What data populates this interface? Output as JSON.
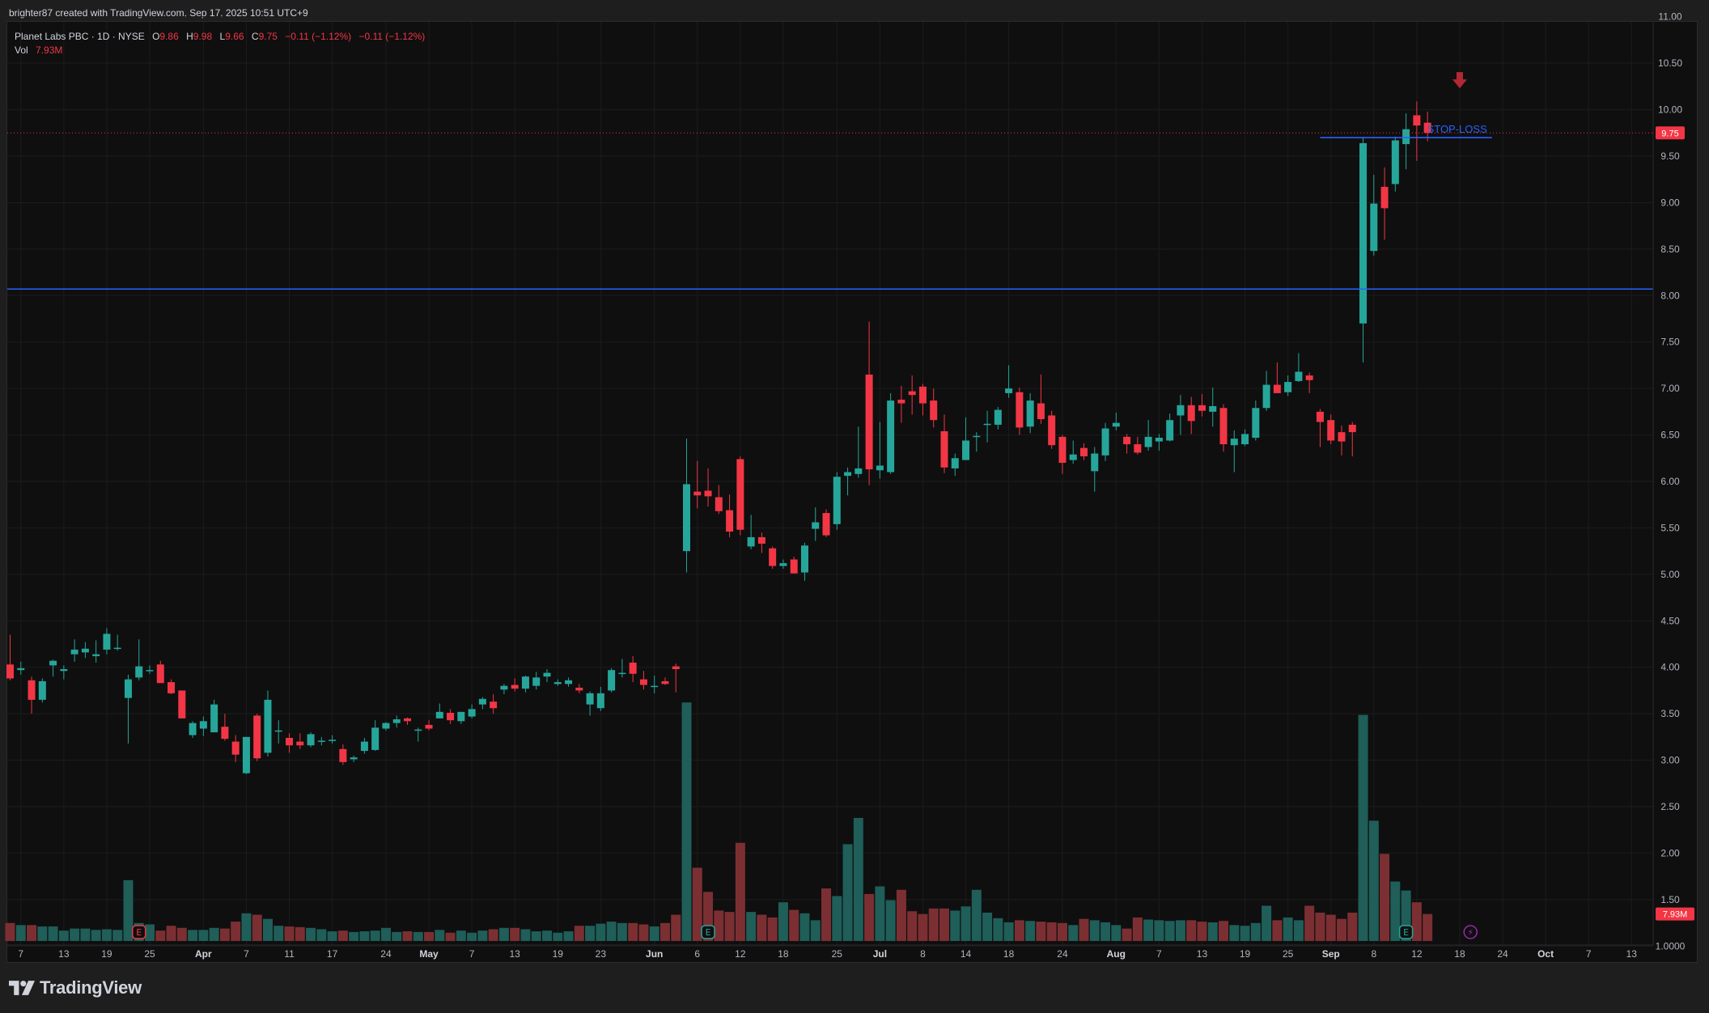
{
  "header": {
    "credit": "brighter87 created with TradingView.com, Sep 17, 2025 10:51 UTC+9"
  },
  "legend": {
    "symbol": "Planet Labs PBC · 1D · NYSE",
    "o_label": "O",
    "o_value": "9.86",
    "h_label": "H",
    "h_value": "9.98",
    "l_label": "L",
    "l_value": "9.66",
    "c_label": "C",
    "c_value": "9.75",
    "change": "−0.11 (−1.12%)",
    "change2": "−0.11 (−1.12%)",
    "vol_label": "Vol",
    "vol_value": "7.93M"
  },
  "footer": {
    "logo_text": "TradingView"
  },
  "colors": {
    "up": "#26a69a",
    "down": "#f23645",
    "up_volume": "#1f5e59",
    "down_volume": "#7c2f32",
    "hline": "#2962ff",
    "background": "#0f0f0f",
    "grid": "#1c1c1c",
    "axis_text": "#b2b5be"
  },
  "chart_data": {
    "type": "candlestick",
    "symbol": "Planet Labs PBC",
    "interval": "1D",
    "exchange": "NYSE",
    "ylim": [
      0.95,
      11.05
    ],
    "y_ticks": [
      "11.00",
      "10.50",
      "10.00",
      "9.50",
      "9.00",
      "8.50",
      "8.00",
      "7.50",
      "7.00",
      "6.50",
      "6.00",
      "5.50",
      "5.00",
      "4.50",
      "4.00",
      "3.50",
      "3.00",
      "2.50",
      "2.00",
      "1.50",
      "1.0000"
    ],
    "x_labels": [
      "7",
      "13",
      "19",
      "25",
      "Apr",
      "7",
      "11",
      "17",
      "24",
      "May",
      "7",
      "13",
      "19",
      "23",
      "Jun",
      "6",
      "12",
      "18",
      "25",
      "Jul",
      "8",
      "14",
      "18",
      "24",
      "Aug",
      "7",
      "13",
      "19",
      "25",
      "Sep",
      "8",
      "12",
      "18",
      "24",
      "Oct",
      "7",
      "13"
    ],
    "x_label_bold": [
      "Apr",
      "May",
      "Jun",
      "Jul",
      "Aug",
      "Sep",
      "Oct"
    ],
    "x_label_bar_pos": [
      1,
      5,
      9,
      13,
      18,
      22,
      26,
      30,
      35,
      39,
      43,
      47,
      51,
      55,
      60,
      64,
      68,
      72,
      77,
      81,
      85,
      89,
      93,
      98,
      103,
      107,
      111,
      115,
      119,
      123,
      127,
      131,
      135,
      139,
      143,
      147,
      151
    ],
    "candles": [
      {
        "o": 4.03,
        "h": 4.35,
        "l": 3.86,
        "c": 3.88
      },
      {
        "o": 3.97,
        "h": 4.06,
        "l": 3.92,
        "c": 3.99
      },
      {
        "o": 3.86,
        "h": 3.9,
        "l": 3.5,
        "c": 3.65
      },
      {
        "o": 3.65,
        "h": 3.88,
        "l": 3.62,
        "c": 3.85
      },
      {
        "o": 4.02,
        "h": 4.08,
        "l": 3.9,
        "c": 4.07
      },
      {
        "o": 3.96,
        "h": 4.02,
        "l": 3.87,
        "c": 3.98
      },
      {
        "o": 4.14,
        "h": 4.3,
        "l": 4.06,
        "c": 4.19
      },
      {
        "o": 4.16,
        "h": 4.27,
        "l": 4.1,
        "c": 4.2
      },
      {
        "o": 4.12,
        "h": 4.29,
        "l": 4.05,
        "c": 4.14
      },
      {
        "o": 4.19,
        "h": 4.42,
        "l": 4.14,
        "c": 4.36
      },
      {
        "o": 4.21,
        "h": 4.35,
        "l": 4.18,
        "c": 4.21
      },
      {
        "o": 3.67,
        "h": 3.92,
        "l": 3.18,
        "c": 3.87
      },
      {
        "o": 3.89,
        "h": 4.3,
        "l": 3.86,
        "c": 4.01
      },
      {
        "o": 3.97,
        "h": 4.02,
        "l": 3.93,
        "c": 3.97
      },
      {
        "o": 4.03,
        "h": 4.07,
        "l": 3.86,
        "c": 3.83
      },
      {
        "o": 3.84,
        "h": 3.87,
        "l": 3.71,
        "c": 3.72
      },
      {
        "o": 3.75,
        "h": 3.75,
        "l": 3.45,
        "c": 3.45
      },
      {
        "o": 3.27,
        "h": 3.42,
        "l": 3.24,
        "c": 3.4
      },
      {
        "o": 3.34,
        "h": 3.47,
        "l": 3.26,
        "c": 3.42
      },
      {
        "o": 3.3,
        "h": 3.65,
        "l": 3.3,
        "c": 3.6
      },
      {
        "o": 3.36,
        "h": 3.5,
        "l": 3.21,
        "c": 3.23
      },
      {
        "o": 3.2,
        "h": 3.27,
        "l": 2.98,
        "c": 3.06
      },
      {
        "o": 2.86,
        "h": 3.25,
        "l": 2.85,
        "c": 3.25
      },
      {
        "o": 3.48,
        "h": 3.5,
        "l": 2.99,
        "c": 3.02
      },
      {
        "o": 3.08,
        "h": 3.75,
        "l": 3.04,
        "c": 3.65
      },
      {
        "o": 3.32,
        "h": 3.43,
        "l": 3.18,
        "c": 3.32
      },
      {
        "o": 3.24,
        "h": 3.29,
        "l": 3.08,
        "c": 3.16
      },
      {
        "o": 3.2,
        "h": 3.29,
        "l": 3.12,
        "c": 3.16
      },
      {
        "o": 3.16,
        "h": 3.3,
        "l": 3.14,
        "c": 3.28
      },
      {
        "o": 3.2,
        "h": 3.25,
        "l": 3.16,
        "c": 3.21
      },
      {
        "o": 3.22,
        "h": 3.27,
        "l": 3.18,
        "c": 3.22
      },
      {
        "o": 3.12,
        "h": 3.17,
        "l": 2.95,
        "c": 2.98
      },
      {
        "o": 3.01,
        "h": 3.05,
        "l": 2.98,
        "c": 3.03
      },
      {
        "o": 3.1,
        "h": 3.24,
        "l": 3.07,
        "c": 3.2
      },
      {
        "o": 3.11,
        "h": 3.43,
        "l": 3.1,
        "c": 3.35
      },
      {
        "o": 3.34,
        "h": 3.41,
        "l": 3.32,
        "c": 3.4
      },
      {
        "o": 3.4,
        "h": 3.48,
        "l": 3.35,
        "c": 3.44
      },
      {
        "o": 3.45,
        "h": 3.46,
        "l": 3.38,
        "c": 3.42
      },
      {
        "o": 3.33,
        "h": 3.35,
        "l": 3.2,
        "c": 3.33
      },
      {
        "o": 3.38,
        "h": 3.43,
        "l": 3.32,
        "c": 3.34
      },
      {
        "o": 3.45,
        "h": 3.61,
        "l": 3.45,
        "c": 3.52
      },
      {
        "o": 3.51,
        "h": 3.55,
        "l": 3.39,
        "c": 3.43
      },
      {
        "o": 3.42,
        "h": 3.52,
        "l": 3.39,
        "c": 3.52
      },
      {
        "o": 3.47,
        "h": 3.6,
        "l": 3.45,
        "c": 3.55
      },
      {
        "o": 3.6,
        "h": 3.68,
        "l": 3.55,
        "c": 3.66
      },
      {
        "o": 3.63,
        "h": 3.71,
        "l": 3.5,
        "c": 3.56
      },
      {
        "o": 3.76,
        "h": 3.82,
        "l": 3.71,
        "c": 3.8
      },
      {
        "o": 3.81,
        "h": 3.88,
        "l": 3.74,
        "c": 3.77
      },
      {
        "o": 3.77,
        "h": 3.91,
        "l": 3.73,
        "c": 3.9
      },
      {
        "o": 3.8,
        "h": 3.95,
        "l": 3.76,
        "c": 3.89
      },
      {
        "o": 3.9,
        "h": 3.98,
        "l": 3.84,
        "c": 3.94
      },
      {
        "o": 3.82,
        "h": 3.87,
        "l": 3.8,
        "c": 3.84
      },
      {
        "o": 3.82,
        "h": 3.89,
        "l": 3.79,
        "c": 3.86
      },
      {
        "o": 3.78,
        "h": 3.82,
        "l": 3.72,
        "c": 3.75
      },
      {
        "o": 3.6,
        "h": 3.74,
        "l": 3.48,
        "c": 3.72
      },
      {
        "o": 3.56,
        "h": 3.79,
        "l": 3.53,
        "c": 3.72
      },
      {
        "o": 3.75,
        "h": 3.99,
        "l": 3.73,
        "c": 3.97
      },
      {
        "o": 3.94,
        "h": 4.09,
        "l": 3.89,
        "c": 3.94
      },
      {
        "o": 4.05,
        "h": 4.12,
        "l": 3.84,
        "c": 3.93
      },
      {
        "o": 3.87,
        "h": 3.96,
        "l": 3.76,
        "c": 3.81
      },
      {
        "o": 3.8,
        "h": 3.91,
        "l": 3.72,
        "c": 3.8
      },
      {
        "o": 3.85,
        "h": 3.89,
        "l": 3.81,
        "c": 3.82
      },
      {
        "o": 4.01,
        "h": 4.04,
        "l": 3.73,
        "c": 3.98
      },
      {
        "o": 5.25,
        "h": 6.46,
        "l": 5.02,
        "c": 5.97
      },
      {
        "o": 5.89,
        "h": 6.22,
        "l": 5.71,
        "c": 5.85
      },
      {
        "o": 5.9,
        "h": 6.14,
        "l": 5.73,
        "c": 5.84
      },
      {
        "o": 5.83,
        "h": 5.96,
        "l": 5.65,
        "c": 5.68
      },
      {
        "o": 5.69,
        "h": 5.86,
        "l": 5.4,
        "c": 5.46
      },
      {
        "o": 6.24,
        "h": 6.27,
        "l": 5.42,
        "c": 5.48
      },
      {
        "o": 5.3,
        "h": 5.64,
        "l": 5.27,
        "c": 5.4
      },
      {
        "o": 5.4,
        "h": 5.45,
        "l": 5.23,
        "c": 5.33
      },
      {
        "o": 5.28,
        "h": 5.3,
        "l": 5.06,
        "c": 5.09
      },
      {
        "o": 5.09,
        "h": 5.16,
        "l": 5.06,
        "c": 5.12
      },
      {
        "o": 5.16,
        "h": 5.19,
        "l": 5.01,
        "c": 5.01
      },
      {
        "o": 5.02,
        "h": 5.34,
        "l": 4.93,
        "c": 5.31
      },
      {
        "o": 5.49,
        "h": 5.72,
        "l": 5.36,
        "c": 5.56
      },
      {
        "o": 5.66,
        "h": 5.7,
        "l": 5.4,
        "c": 5.42
      },
      {
        "o": 5.54,
        "h": 6.1,
        "l": 5.48,
        "c": 6.05
      },
      {
        "o": 6.06,
        "h": 6.15,
        "l": 5.85,
        "c": 6.1
      },
      {
        "o": 6.08,
        "h": 6.59,
        "l": 6.04,
        "c": 6.14
      },
      {
        "o": 7.15,
        "h": 7.72,
        "l": 5.96,
        "c": 6.13
      },
      {
        "o": 6.12,
        "h": 6.64,
        "l": 6.03,
        "c": 6.17
      },
      {
        "o": 6.1,
        "h": 6.95,
        "l": 6.08,
        "c": 6.87
      },
      {
        "o": 6.88,
        "h": 7.03,
        "l": 6.63,
        "c": 6.84
      },
      {
        "o": 6.97,
        "h": 7.14,
        "l": 6.72,
        "c": 6.93
      },
      {
        "o": 7.02,
        "h": 7.05,
        "l": 6.71,
        "c": 6.84
      },
      {
        "o": 6.87,
        "h": 7.0,
        "l": 6.58,
        "c": 6.66
      },
      {
        "o": 6.54,
        "h": 6.72,
        "l": 6.09,
        "c": 6.15
      },
      {
        "o": 6.14,
        "h": 6.3,
        "l": 6.06,
        "c": 6.25
      },
      {
        "o": 6.23,
        "h": 6.69,
        "l": 6.23,
        "c": 6.44
      },
      {
        "o": 6.48,
        "h": 6.53,
        "l": 6.32,
        "c": 6.49
      },
      {
        "o": 6.61,
        "h": 6.76,
        "l": 6.42,
        "c": 6.62
      },
      {
        "o": 6.61,
        "h": 6.8,
        "l": 6.56,
        "c": 6.77
      },
      {
        "o": 6.95,
        "h": 7.25,
        "l": 6.9,
        "c": 7.0
      },
      {
        "o": 6.96,
        "h": 7.01,
        "l": 6.5,
        "c": 6.58
      },
      {
        "o": 6.59,
        "h": 6.95,
        "l": 6.52,
        "c": 6.87
      },
      {
        "o": 6.84,
        "h": 7.15,
        "l": 6.62,
        "c": 6.67
      },
      {
        "o": 6.71,
        "h": 6.76,
        "l": 6.35,
        "c": 6.39
      },
      {
        "o": 6.48,
        "h": 6.5,
        "l": 6.08,
        "c": 6.2
      },
      {
        "o": 6.23,
        "h": 6.44,
        "l": 6.19,
        "c": 6.29
      },
      {
        "o": 6.36,
        "h": 6.41,
        "l": 6.23,
        "c": 6.27
      },
      {
        "o": 6.11,
        "h": 6.37,
        "l": 5.89,
        "c": 6.3
      },
      {
        "o": 6.28,
        "h": 6.63,
        "l": 6.22,
        "c": 6.57
      },
      {
        "o": 6.59,
        "h": 6.74,
        "l": 6.55,
        "c": 6.63
      },
      {
        "o": 6.48,
        "h": 6.51,
        "l": 6.3,
        "c": 6.4
      },
      {
        "o": 6.4,
        "h": 6.48,
        "l": 6.29,
        "c": 6.31
      },
      {
        "o": 6.37,
        "h": 6.66,
        "l": 6.33,
        "c": 6.48
      },
      {
        "o": 6.43,
        "h": 6.51,
        "l": 6.33,
        "c": 6.47
      },
      {
        "o": 6.44,
        "h": 6.73,
        "l": 6.43,
        "c": 6.66
      },
      {
        "o": 6.71,
        "h": 6.93,
        "l": 6.5,
        "c": 6.82
      },
      {
        "o": 6.82,
        "h": 6.91,
        "l": 6.51,
        "c": 6.65
      },
      {
        "o": 6.82,
        "h": 6.94,
        "l": 6.7,
        "c": 6.76
      },
      {
        "o": 6.75,
        "h": 7.01,
        "l": 6.59,
        "c": 6.81
      },
      {
        "o": 6.79,
        "h": 6.83,
        "l": 6.32,
        "c": 6.4
      },
      {
        "o": 6.39,
        "h": 6.55,
        "l": 6.1,
        "c": 6.46
      },
      {
        "o": 6.4,
        "h": 6.56,
        "l": 6.38,
        "c": 6.51
      },
      {
        "o": 6.47,
        "h": 6.87,
        "l": 6.44,
        "c": 6.79
      },
      {
        "o": 6.79,
        "h": 7.19,
        "l": 6.76,
        "c": 7.04
      },
      {
        "o": 7.04,
        "h": 7.28,
        "l": 6.96,
        "c": 6.95
      },
      {
        "o": 6.96,
        "h": 7.14,
        "l": 6.92,
        "c": 7.07
      },
      {
        "o": 7.08,
        "h": 7.38,
        "l": 7.07,
        "c": 7.18
      },
      {
        "o": 7.14,
        "h": 7.17,
        "l": 6.95,
        "c": 7.09
      },
      {
        "o": 6.75,
        "h": 6.78,
        "l": 6.37,
        "c": 6.64
      },
      {
        "o": 6.66,
        "h": 6.72,
        "l": 6.4,
        "c": 6.44
      },
      {
        "o": 6.53,
        "h": 6.6,
        "l": 6.28,
        "c": 6.43
      },
      {
        "o": 6.61,
        "h": 6.64,
        "l": 6.27,
        "c": 6.53
      },
      {
        "o": 7.7,
        "h": 9.7,
        "l": 7.28,
        "c": 9.64
      },
      {
        "o": 8.48,
        "h": 9.3,
        "l": 8.43,
        "c": 8.99
      },
      {
        "o": 9.17,
        "h": 9.38,
        "l": 8.6,
        "c": 8.94
      },
      {
        "o": 9.2,
        "h": 9.71,
        "l": 9.12,
        "c": 9.67
      },
      {
        "o": 9.63,
        "h": 9.96,
        "l": 9.36,
        "c": 9.79
      },
      {
        "o": 9.94,
        "h": 10.09,
        "l": 9.45,
        "c": 9.83
      },
      {
        "o": 9.86,
        "h": 9.98,
        "l": 9.66,
        "c": 9.75
      }
    ],
    "volume_ylim": [
      0,
      33
    ],
    "volumes": [
      2.6,
      2.3,
      2.3,
      2.1,
      2.1,
      1.5,
      1.8,
      1.8,
      1.6,
      1.7,
      1.6,
      8.8,
      2.6,
      2.4,
      1.5,
      2.2,
      1.9,
      1.6,
      1.6,
      1.9,
      1.8,
      2.8,
      4.0,
      3.8,
      3.2,
      2.2,
      2.1,
      2.0,
      1.9,
      1.7,
      1.4,
      1.5,
      1.3,
      1.4,
      1.5,
      1.9,
      1.3,
      1.4,
      1.3,
      1.3,
      1.6,
      1.2,
      1.5,
      1.2,
      1.5,
      1.7,
      1.9,
      1.9,
      1.7,
      1.4,
      1.5,
      1.2,
      1.4,
      2.2,
      2.2,
      2.5,
      2.8,
      2.6,
      2.6,
      2.4,
      2.1,
      2.6,
      3.8,
      34.5,
      10.6,
      7.1,
      4.4,
      4.2,
      14.2,
      4.2,
      3.8,
      3.4,
      5.6,
      4.5,
      4.0,
      3.0,
      7.6,
      6.5,
      14.0,
      17.8,
      6.8,
      7.9,
      5.9,
      7.4,
      4.3,
      3.9,
      4.7,
      4.7,
      4.4,
      5.0,
      7.4,
      4.1,
      3.3,
      2.7,
      3.0,
      2.9,
      2.8,
      2.7,
      2.6,
      2.3,
      3.2,
      3.0,
      2.7,
      2.3,
      1.8,
      3.4,
      3.1,
      3.0,
      2.9,
      3.0,
      3.0,
      2.8,
      2.7,
      2.9,
      2.3,
      2.2,
      2.6,
      5.1,
      3.0,
      3.4,
      3.0,
      5.1,
      4.1,
      3.8,
      3.2,
      4.1,
      32.7,
      17.4,
      12.6,
      8.6,
      7.3,
      5.6,
      3.9
    ],
    "events": [
      {
        "bar": 12,
        "type": "earnings",
        "label": "E"
      },
      {
        "bar": 65,
        "type": "earnings",
        "label": "E"
      },
      {
        "bar": 130,
        "type": "earnings",
        "label": "E"
      },
      {
        "bar": 136,
        "type": "dividend-split",
        "label": "⚡"
      }
    ],
    "horizontal_lines": [
      {
        "y": 8.07,
        "extends": "full",
        "label": ""
      },
      {
        "y": 9.7,
        "from_bar": 122,
        "to_bar": 138,
        "label": "STOP-LOSS"
      }
    ],
    "arrow_marker": {
      "bar": 135,
      "y": 10.3,
      "direction": "down"
    },
    "last_price": {
      "value": 9.75,
      "label": "9.75"
    },
    "last_volume_label": "7.93M"
  }
}
